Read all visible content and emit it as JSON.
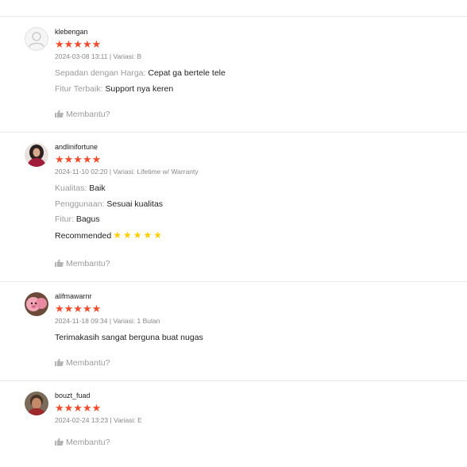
{
  "colors": {
    "star": "#ee4d2d",
    "inline_star": "#ffcc00",
    "muted": "#9b9b9b",
    "separator": "#e8e8e8"
  },
  "reviews": [
    {
      "username": "klebengan",
      "rating_stars": "★★★★★",
      "rating": 5,
      "meta": "2024-03-08 13:11 | Variasi: B",
      "avatar": "default-user-icon",
      "attributes": [
        {
          "key": "Sepadan dengan Harga: ",
          "value": "Cepat ga bertele tele"
        },
        {
          "key": "Fitur Terbaik: ",
          "value": "Support nya keren"
        }
      ],
      "helpful_label": "Membantu?"
    },
    {
      "username": "andlinifortune",
      "rating_stars": "★★★★★",
      "rating": 5,
      "meta": "2024-11-10 02:20 | Variasi: Lifetime w/ Warranty",
      "avatar": "user-photo-avatar",
      "attributes": [
        {
          "key": "Kualitas: ",
          "value": "Baik"
        },
        {
          "key": "Penggunaan: ",
          "value": "Sesuai kualitas"
        },
        {
          "key": "Fitur: ",
          "value": "Bagus"
        }
      ],
      "comment": "Recommended",
      "comment_stars": "★★★★★",
      "helpful_label": "Membantu?"
    },
    {
      "username": "alifmawarnr",
      "rating_stars": "★★★★★",
      "rating": 5,
      "meta": "2024-11-18 09:34 | Variasi: 1 Bulan",
      "avatar": "user-photo-avatar",
      "comment": "Terimakasih sangat berguna buat nugas",
      "helpful_label": "Membantu?"
    },
    {
      "username": "bouzt_fuad",
      "rating_stars": "★★★★★",
      "rating": 5,
      "meta": "2024-02-24 13:23 | Variasi: E",
      "avatar": "user-photo-avatar",
      "helpful_label": "Membantu?"
    }
  ]
}
